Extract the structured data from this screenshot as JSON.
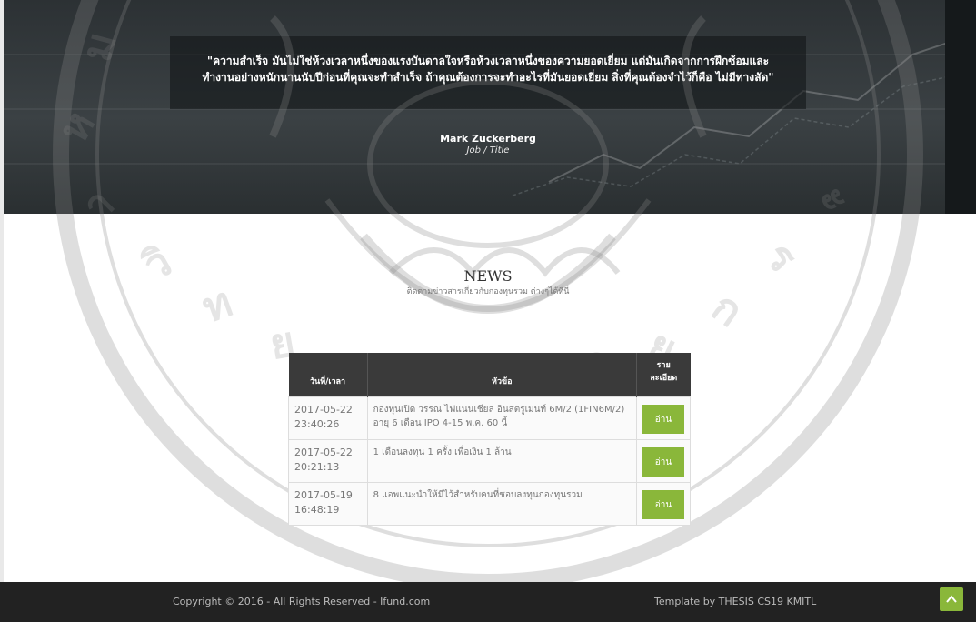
{
  "hero": {
    "quote_line1": "\"ความสำเร็จ มันไม่ใช่ห้วงเวลาหนึ่งของแรงบันดาลใจหรือห้วงเวลาหนึ่งของความยอดเยี่ยม แต่มันเกิดจากการฝึกซ้อมและ",
    "quote_line2": "ทำงานอย่างหนักนานนับปีก่อนที่คุณจะทำสำเร็จ ถ้าคุณต้องการจะทำอะไรที่มันยอดเยี่ยม สิ่งที่คุณต้องจำไว้ก็คือ ไม่มีทางลัด\"",
    "author": "Mark Zuckerberg",
    "author_title": "Job / Title"
  },
  "news": {
    "title": "NEWS",
    "subtitle": "ติดตามข่าวสารเกี่ยวกับกองทุนรวม ต่างๆได้ที่นี่",
    "columns": {
      "date": "วันที่/เวลา",
      "topic": "หัวข้อ",
      "detail_line1": "ราย",
      "detail_line2": "ละเอียด"
    },
    "read_label": "อ่าน",
    "rows": [
      {
        "date": "2017-05-22",
        "time": "23:40:26",
        "topic": "กองทุนเปิด วรรณ ไฟแนนเชียล อินสตรูเมนท์ 6M/2 (1FIN6M/2) อายุ 6 เดือน IPO 4-15 พ.ค. 60 นี้"
      },
      {
        "date": "2017-05-22",
        "time": "20:21:13",
        "topic": "1 เดือนลงทุน 1 ครั้ง เพื่อเงิน 1 ล้าน"
      },
      {
        "date": "2017-05-19",
        "time": "16:48:19",
        "topic": "8 แอพแนะนำให้มีไว้สำหรับคนที่ชอบลงทุนกองทุนรวม"
      }
    ]
  },
  "footer": {
    "copyright": "Copyright © 2016 - All Rights Reserved - Ifund.com",
    "credit": "Template by THESIS CS19 KMITL"
  },
  "colors": {
    "accent": "#8ab73a",
    "footer_bg": "#222222",
    "table_header_bg": "#3a3a3a"
  },
  "icons": {
    "scroll_top": "chevron-up-icon"
  }
}
